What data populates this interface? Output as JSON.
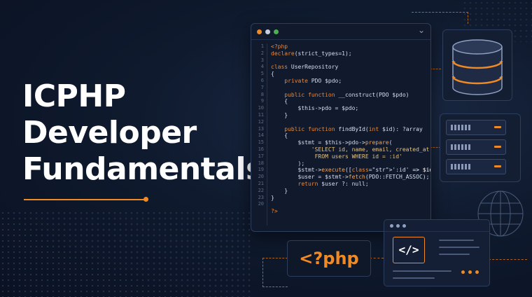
{
  "headline": {
    "line1": "ICPHP",
    "line2": "Developer",
    "line3": "Fundamentals"
  },
  "colors": {
    "accent": "#f08a24",
    "background": "#0f1a2e",
    "panel": "#111a2c"
  },
  "editor": {
    "window_dots": [
      "#f08a24",
      "#c7cfdc",
      "#4caf50"
    ],
    "chevron_icon": "chevron-down-icon",
    "lines": [
      {
        "n": "1",
        "t": "<?php"
      },
      {
        "n": "2",
        "t": "declare(strict_types=1);"
      },
      {
        "n": "3",
        "t": ""
      },
      {
        "n": "4",
        "t": "class UserRepository"
      },
      {
        "n": "5",
        "t": "{"
      },
      {
        "n": "6",
        "t": "    private PDO $pdo;"
      },
      {
        "n": "7",
        "t": ""
      },
      {
        "n": "8",
        "t": "    public function __construct(PDO $pdo)"
      },
      {
        "n": "9",
        "t": "    {"
      },
      {
        "n": "10",
        "t": "        $this->pdo = $pdo;"
      },
      {
        "n": "11",
        "t": "    }"
      },
      {
        "n": "12",
        "t": ""
      },
      {
        "n": "13",
        "t": "    public function findById(int $id): ?array"
      },
      {
        "n": "14",
        "t": "    {"
      },
      {
        "n": "15",
        "t": "        $stmt = $this->pdo->prepare("
      },
      {
        "n": "16",
        "t": "            'SELECT id, name, email, created_at"
      },
      {
        "n": "17",
        "t": "             FROM users WHERE id = :id'"
      },
      {
        "n": "18",
        "t": "        );"
      },
      {
        "n": "19",
        "t": "        $stmt->execute([':id' => $id]);"
      },
      {
        "n": "20",
        "t": "        $user = $stmt->fetch(PDO::FETCH_ASSOC);"
      },
      {
        "n": "21",
        "t": "        return $user ?: null;"
      },
      {
        "n": "22",
        "t": "    }"
      },
      {
        "n": "23",
        "t": "}"
      },
      {
        "n": "20",
        "t": ""
      },
      {
        "n": "",
        "t": "?>"
      }
    ]
  },
  "php_tag": "<?php",
  "code_card": {
    "icon_label": "</>"
  },
  "icons": {
    "database": "database-icon",
    "server": "server-rack-icon",
    "globe": "globe-icon"
  }
}
